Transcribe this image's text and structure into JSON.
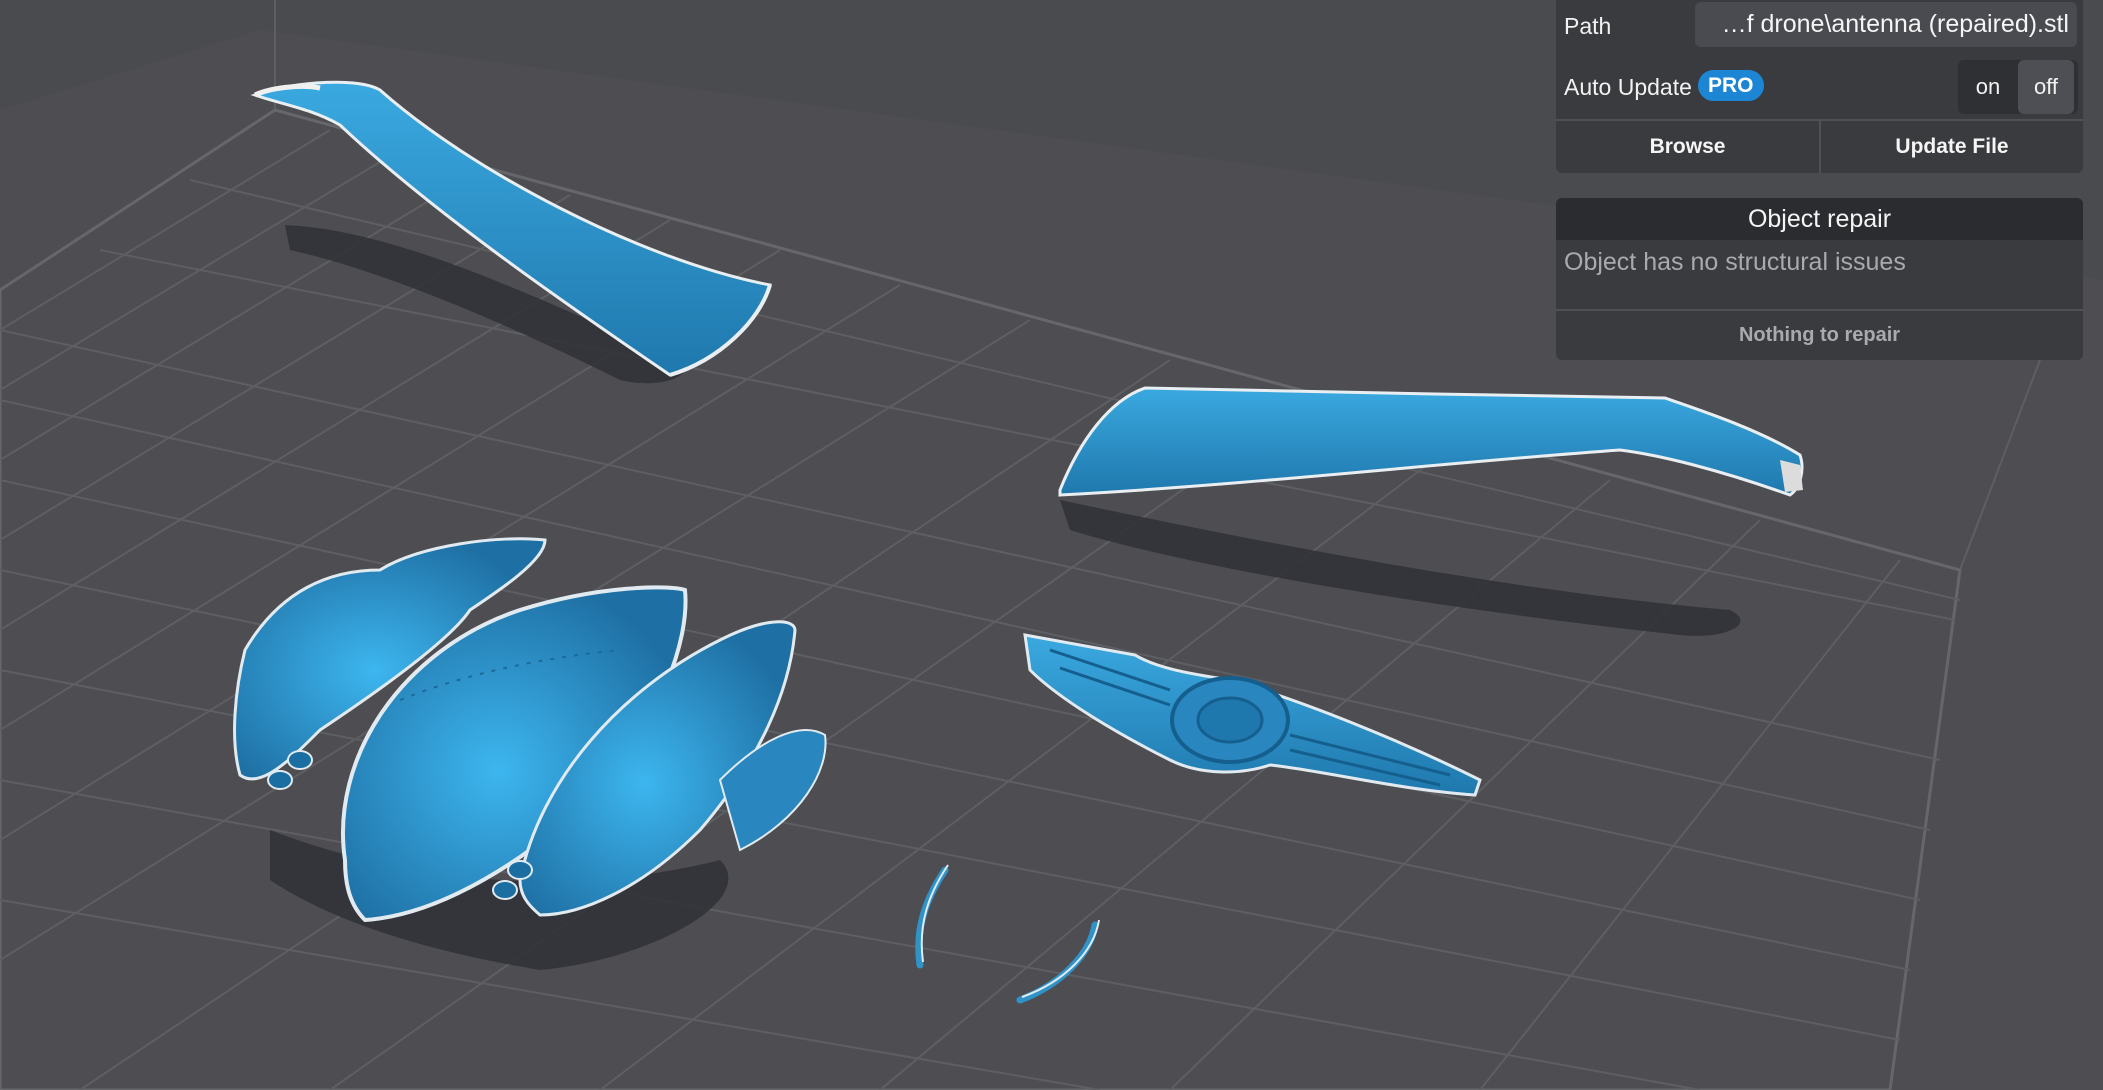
{
  "file_panel": {
    "path_label": "Path",
    "path_value": "…f drone\\antenna (repaired).stl",
    "auto_update_label": "Auto Update",
    "pro_badge": "PRO",
    "toggle_on": "on",
    "toggle_off": "off",
    "toggle_selected": "off",
    "browse_label": "Browse",
    "update_label": "Update File"
  },
  "repair_panel": {
    "title": "Object repair",
    "message": "Object has no structural issues",
    "action_label": "Nothing to repair"
  },
  "scene": {
    "objects": [
      "wing-left",
      "wing-right",
      "fuselage",
      "emblem-wings",
      "antenna-pieces"
    ],
    "model_color": "#2f93c8",
    "background_color": "#4a4b4f",
    "grid_color": "#5e5f63"
  }
}
